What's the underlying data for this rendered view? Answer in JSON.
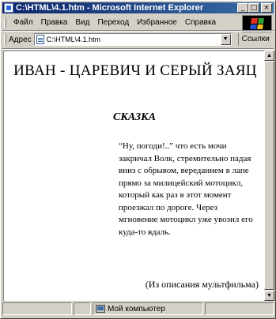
{
  "window": {
    "title": "C:\\HTML\\4.1.htm - Microsoft Internet Explorer",
    "controls": {
      "minimize": "_",
      "maximize": "□",
      "close": "×"
    }
  },
  "menu": [
    "Файл",
    "Правка",
    "Вид",
    "Переход",
    "Избранное",
    "Справка"
  ],
  "address": {
    "label": "Адрес",
    "value": "C:\\HTML\\4.1.htm",
    "links_label": "Ссылки"
  },
  "document": {
    "title": "ИВАН - ЦАРЕВИЧ И СЕРЫЙ ЗАЯЦ",
    "subtitle": "СКАЗКА",
    "quote": "“Ну, погоди!..” что есть мочи закричал Волк, стремительно падая вниз с обрывом, вереданием в лапе прямо за милицейский мотоцикл, который как раз в этот момент проезжал по дороге. Через мгновение мотоцикл уже увозил его куда-то вдаль.",
    "source": "(Из описания мультфильма)"
  },
  "status": {
    "zone": "Мой компьютер"
  },
  "colors": {
    "titlebar_start": "#0a246a",
    "titlebar_end": "#3a6ea5",
    "chrome": "#d4d0c8"
  },
  "icons": [
    "ie-page-icon",
    "windows-logo-icon",
    "page-icon",
    "computer-icon"
  ]
}
